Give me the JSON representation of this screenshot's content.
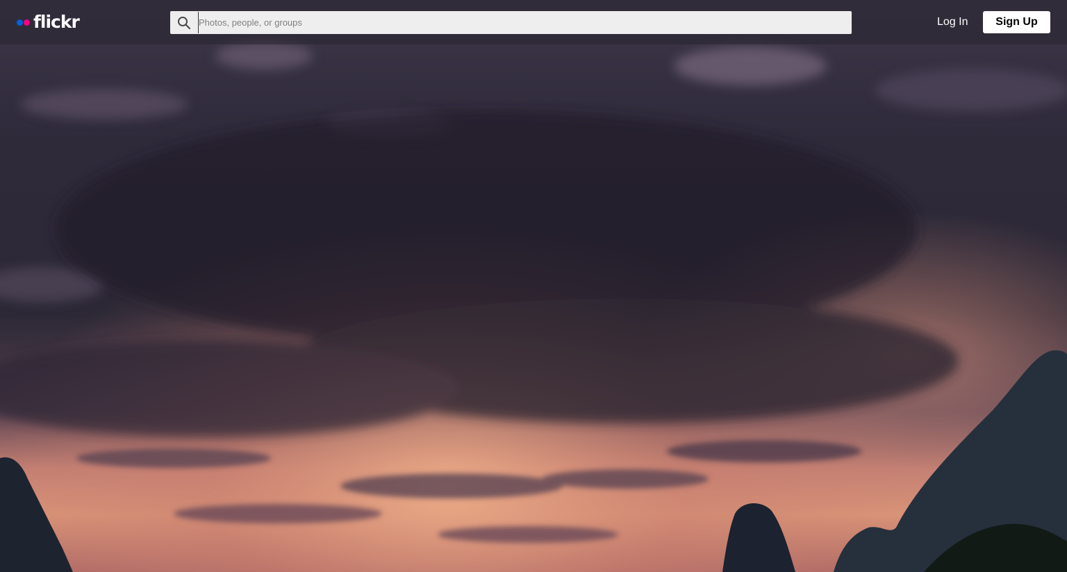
{
  "brand": {
    "name": "flickr",
    "dot_blue": "#0063dc",
    "dot_pink": "#ff0084"
  },
  "search": {
    "placeholder": "Photos, people, or groups",
    "value": "",
    "icon": "search-icon"
  },
  "auth": {
    "login_label": "Log In",
    "signup_label": "Sign Up"
  },
  "colors": {
    "header_bg": "rgba(40,36,48,0.55)",
    "sky_dark": "#2f2a3c",
    "sunset": "#d98b73"
  }
}
